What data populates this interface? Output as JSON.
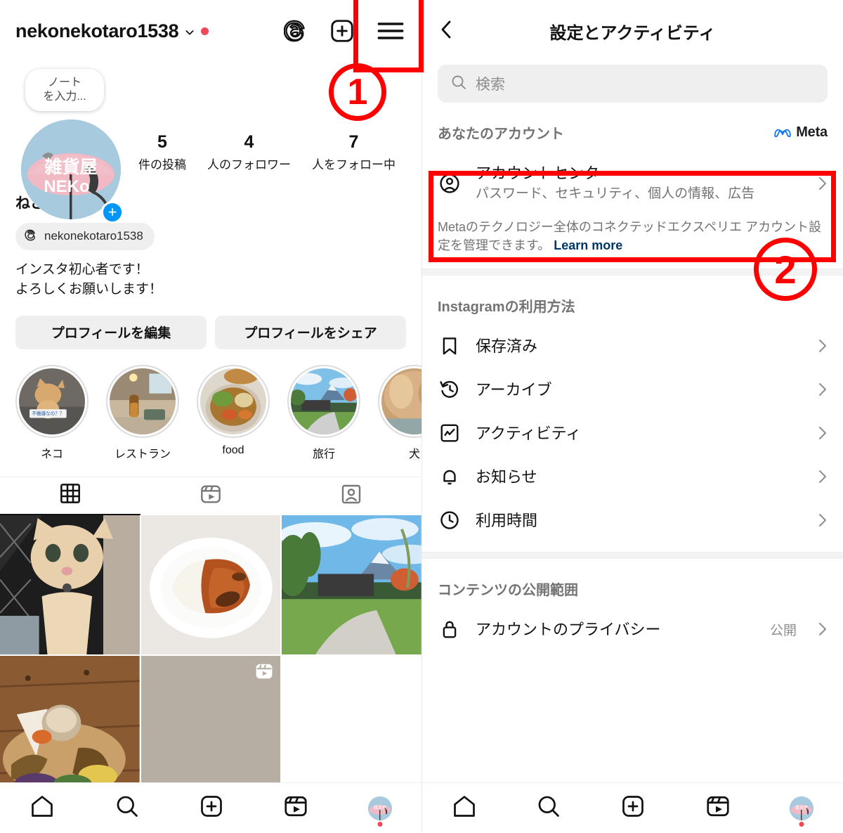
{
  "profile": {
    "username": "nekonekotaro1538",
    "has_unread_dot": true,
    "note_bubble": "ノート\nを入力...",
    "avatar_text_top": "雑貨屋",
    "avatar_text_bottom": "NEKo",
    "add_story_label": "+",
    "stats": [
      {
        "num": "5",
        "label": "件の投稿"
      },
      {
        "num": "4",
        "label": "人のフォロワー"
      },
      {
        "num": "7",
        "label": "人をフォロー中"
      }
    ],
    "display_name": "ねこ 太郎",
    "threads_handle": "nekonekotaro1538",
    "bio": "インスタ初心者です！\nよろしくお願いします！",
    "buttons": [
      {
        "label": "プロフィールを編集"
      },
      {
        "label": "プロフィールをシェア"
      }
    ],
    "highlights": [
      {
        "label": "ネコ",
        "caption": "不機嫌なの？？"
      },
      {
        "label": "レストラン"
      },
      {
        "label": "food"
      },
      {
        "label": "旅行"
      },
      {
        "label": "犬"
      }
    ],
    "tabs": [
      {
        "icon": "grid-icon",
        "active": true
      },
      {
        "icon": "reels-icon",
        "active": false
      },
      {
        "icon": "tagged-icon",
        "active": false
      }
    ],
    "posts": [
      {
        "kind": "cat-photo"
      },
      {
        "kind": "curry-rice-photo"
      },
      {
        "kind": "mountain-park-photo"
      },
      {
        "kind": "cafe-plate-photo"
      },
      {
        "kind": "reel-placeholder",
        "badge": "reels-icon"
      },
      {
        "kind": "empty"
      }
    ]
  },
  "settings": {
    "title": "設定とアクティビティ",
    "back_icon": "chevron-left-icon",
    "search": {
      "placeholder": "検索",
      "icon": "search-icon"
    },
    "account_section": {
      "title": "あなたのアカウント",
      "brand": "Meta",
      "item": {
        "title": "アカウントセンター",
        "subtitle": "パスワード、セキュリティ、個人の情報、広告",
        "icon": "account-circle-icon"
      },
      "helper_text": "Metaのテクノロジー全体のコネクテッドエクスペリエ アカウント設定を管理できます。",
      "helper_link": "Learn more"
    },
    "usage_section": {
      "title": "Instagramの利用方法",
      "items": [
        {
          "label": "保存済み",
          "icon": "bookmark-icon"
        },
        {
          "label": "アーカイブ",
          "icon": "archive-clock-icon"
        },
        {
          "label": "アクティビティ",
          "icon": "activity-chart-icon"
        },
        {
          "label": "お知らせ",
          "icon": "bell-icon"
        },
        {
          "label": "利用時間",
          "icon": "clock-icon"
        }
      ]
    },
    "visibility_section": {
      "title": "コンテンツの公開範囲",
      "items": [
        {
          "label": "アカウントのプライバシー",
          "value": "公開",
          "icon": "lock-icon"
        }
      ]
    }
  },
  "bottom_nav": {
    "items": [
      {
        "icon": "home-icon"
      },
      {
        "icon": "search-icon"
      },
      {
        "icon": "create-icon"
      },
      {
        "icon": "reels-icon"
      },
      {
        "icon": "profile-avatar",
        "dot": true
      }
    ]
  },
  "annotations": {
    "step1": "1",
    "step2": "2",
    "color": "#FF0000"
  }
}
